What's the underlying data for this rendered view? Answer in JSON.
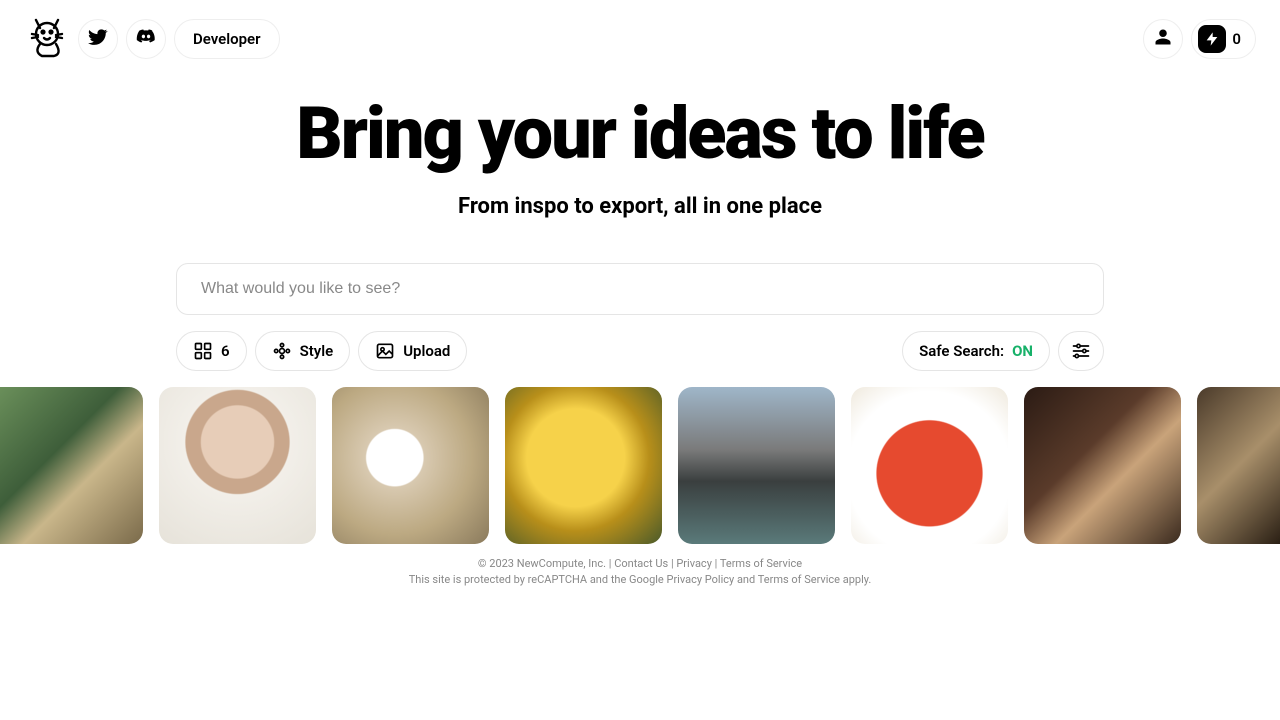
{
  "header": {
    "developer_label": "Developer",
    "credits_count": "0"
  },
  "hero": {
    "title": "Bring your ideas to life",
    "subtitle": "From inspo to export, all in one place"
  },
  "search": {
    "placeholder": "What would you like to see?",
    "value": ""
  },
  "controls": {
    "grid_count": "6",
    "style_label": "Style",
    "upload_label": "Upload",
    "safe_search_label": "Safe Search:",
    "safe_search_state": "ON"
  },
  "gallery_tiles": [
    "",
    "",
    "",
    "",
    "",
    "",
    "",
    ""
  ],
  "footer": {
    "copyright": "© 2023 NewCompute, Inc.",
    "contact": "Contact Us",
    "privacy": "Privacy",
    "terms": "Terms of Service",
    "recaptcha_prefix": "This site is protected by reCAPTCHA and the Google ",
    "recaptcha_pp": "Privacy Policy",
    "recaptcha_and": " and ",
    "recaptcha_tos": "Terms of Service",
    "recaptcha_apply": " apply."
  }
}
